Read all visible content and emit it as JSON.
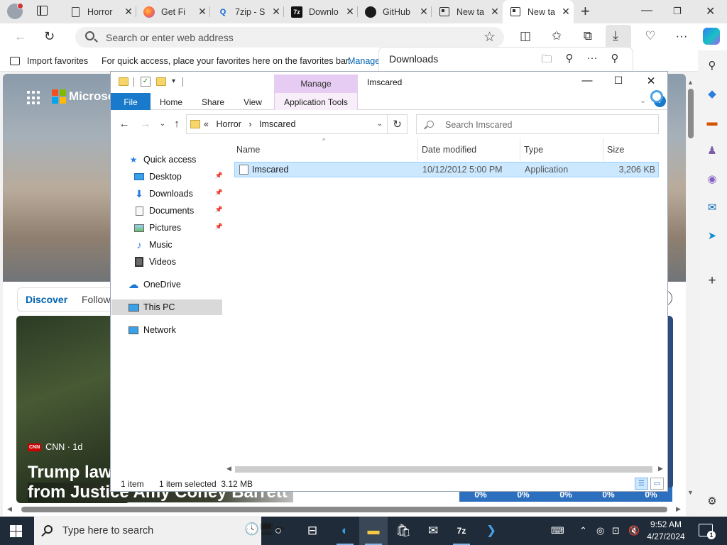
{
  "browser": {
    "tabs": [
      {
        "title": "Horror",
        "icon": "document-icon"
      },
      {
        "title": "Get Fi",
        "icon": "firefox-icon"
      },
      {
        "title": "7zip - S",
        "icon": "search-q-icon"
      },
      {
        "title": "Downlo",
        "icon": "7zip-icon"
      },
      {
        "title": "GitHub",
        "icon": "github-icon"
      },
      {
        "title": "New ta",
        "icon": "newtab-icon"
      },
      {
        "title": "New ta",
        "icon": "newtab-icon",
        "active": true
      }
    ],
    "address_placeholder": "Search or enter web address",
    "favorites_bar": {
      "import_label": "Import favorites",
      "message": "For quick access, place your favorites here on the favorites bar.",
      "manage_link": "Manage"
    },
    "downloads_panel": {
      "title": "Downloads"
    }
  },
  "newtab": {
    "brand": "Microso",
    "feed_tabs": [
      "Discover",
      "Follow"
    ],
    "card": {
      "source_badge": "CNN",
      "source": "CNN · 1d",
      "headline_1": "Trump lawy",
      "headline_2": "from Justice Amy Coney Barrett"
    },
    "weather": [
      "0%",
      "0%",
      "0%",
      "0%",
      "0%"
    ]
  },
  "explorer": {
    "manage_tab": "Manage",
    "window_title": "Imscared",
    "ribbon_tabs": [
      "File",
      "Home",
      "Share",
      "View"
    ],
    "context_tab": "Application Tools",
    "breadcrumb": {
      "overflow": "«",
      "parts": [
        "Horror",
        "Imscared"
      ]
    },
    "search_placeholder": "Search Imscared",
    "nav_pane": {
      "quick_access": "Quick access",
      "quick_items": [
        {
          "label": "Desktop",
          "icon": "desktop-icon",
          "pinned": true
        },
        {
          "label": "Downloads",
          "icon": "downloads-icon",
          "pinned": true
        },
        {
          "label": "Documents",
          "icon": "documents-icon",
          "pinned": true
        },
        {
          "label": "Pictures",
          "icon": "pictures-icon",
          "pinned": true
        },
        {
          "label": "Music",
          "icon": "music-icon",
          "pinned": false
        },
        {
          "label": "Videos",
          "icon": "videos-icon",
          "pinned": false
        }
      ],
      "onedrive": "OneDrive",
      "this_pc": "This PC",
      "network": "Network"
    },
    "columns": [
      "Name",
      "Date modified",
      "Type",
      "Size"
    ],
    "files": [
      {
        "name": "Imscared",
        "date_modified": "10/12/2012 5:00 PM",
        "type": "Application",
        "size": "3,206 KB",
        "selected": true
      }
    ],
    "status": {
      "count": "1 item",
      "selection": "1 item selected  3.12 MB"
    }
  },
  "taskbar": {
    "search_placeholder": "Type here to search",
    "time": "9:52 AM",
    "date": "4/27/2024",
    "notification_count": "1"
  },
  "colors": {
    "accent": "#1979ca",
    "manage_tab": "#e6ccf2",
    "selected_row": "#cce8ff",
    "taskbar": "#1f2b38"
  }
}
